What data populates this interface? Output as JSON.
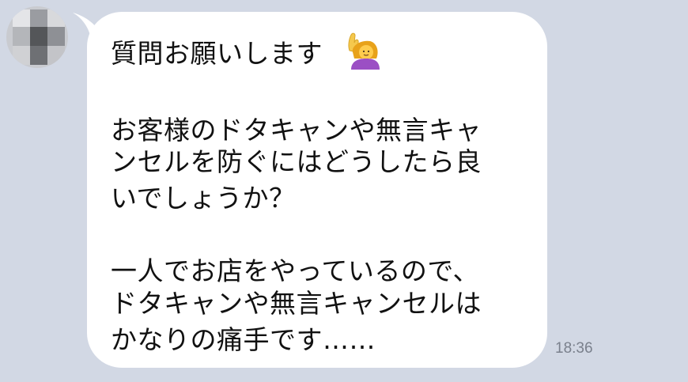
{
  "chat": {
    "message": {
      "lines": [
        "質問お願いします",
        "お客様のドタキャンや無言キャ",
        "ンセルを防ぐにはどうしたら良",
        "いでしょうか？",
        "一人でお店をやっているので、",
        "ドタキャンや無言キャンセルは",
        "かなりの痛手です……"
      ],
      "emoji": "raising-hand-woman",
      "time": "18:36"
    },
    "sender": {
      "avatar": "blurred-avatar"
    },
    "colors": {
      "background": "#d2d8e4",
      "bubble": "#ffffff",
      "text": "#111111",
      "timestamp": "#7a808c"
    }
  }
}
